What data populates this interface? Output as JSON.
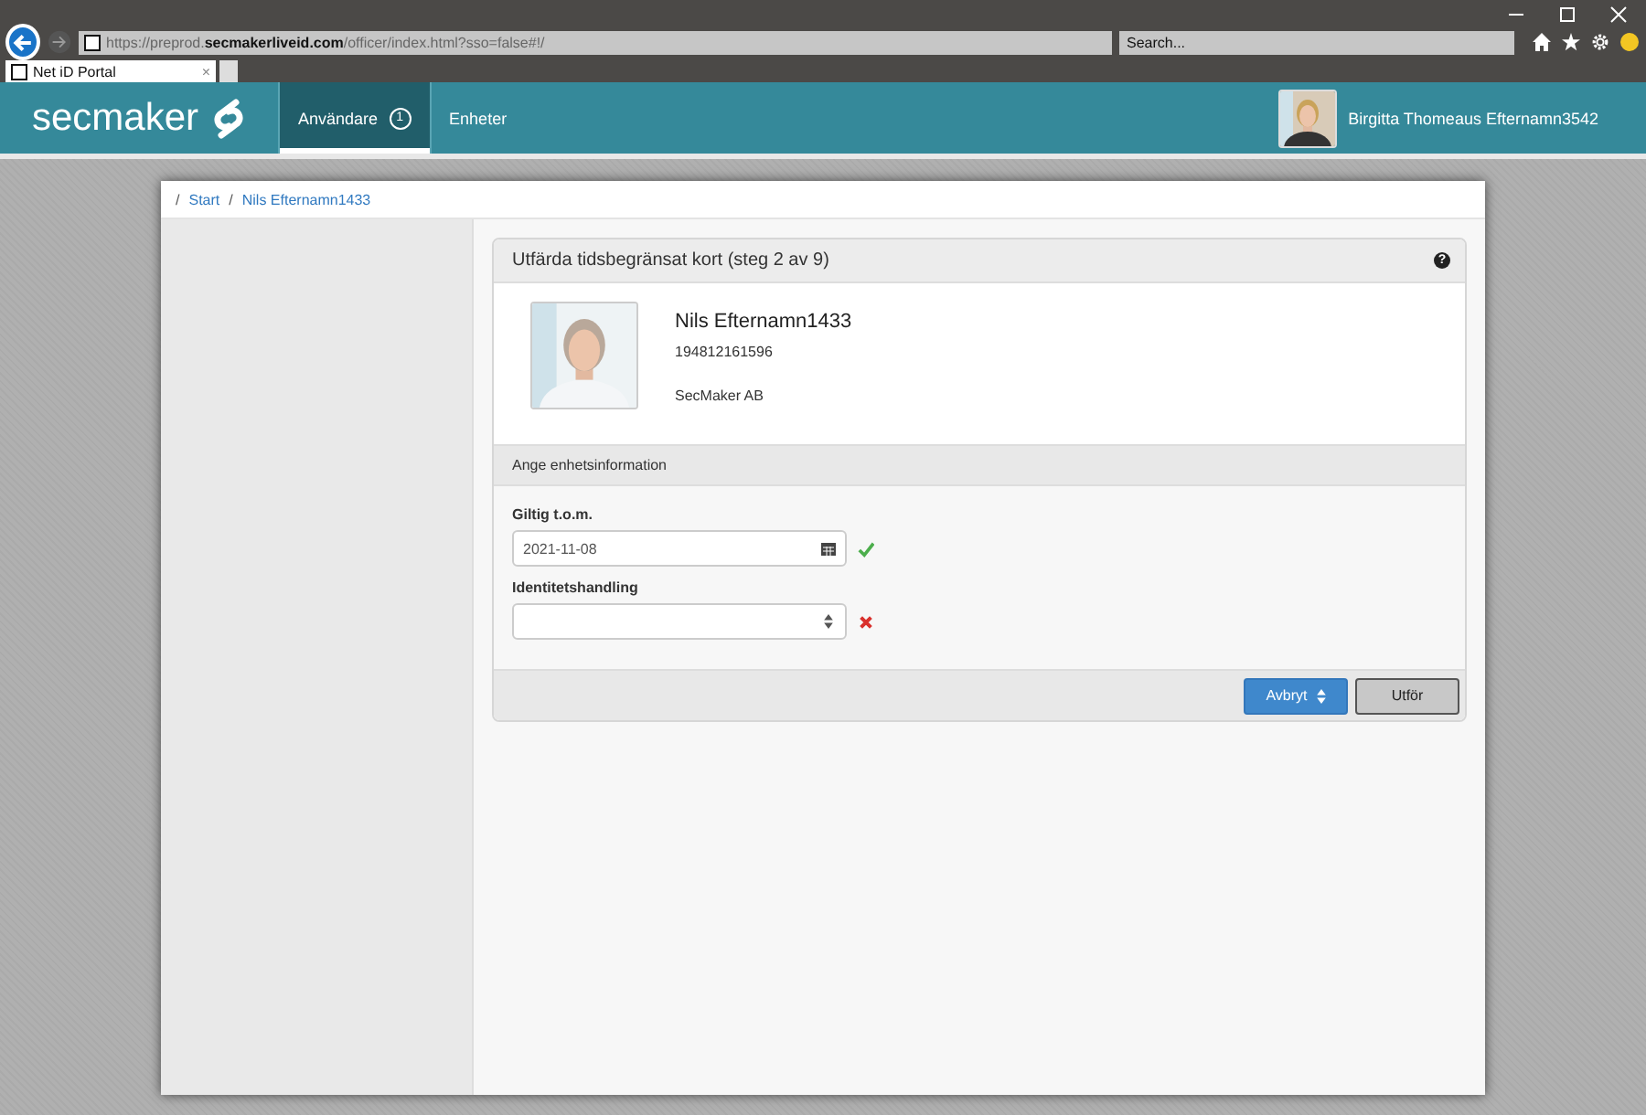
{
  "browser": {
    "url": "https://preprod.**secmakerliveid.com**/officer/index.html?sso=false#!/",
    "search": {
      "placeholder": "Search..."
    },
    "tabs": [
      {
        "label": "Net iD Portal",
        "close": "×",
        "selected": true
      }
    ]
  },
  "header": {
    "logo": "secmaker",
    "nav": [
      {
        "label": "Användare",
        "badge": "1",
        "selected": true
      },
      {
        "label": "Enheter",
        "selected": false
      }
    ],
    "user": "Birgitta Thomeaus Efternamn3542"
  },
  "breadcrumb": [
    {
      "separator": "/",
      "label": "Start"
    },
    {
      "separator": "/",
      "label": "Nils Efternamn1433"
    }
  ],
  "panel": {
    "title": "Utfärda tidsbegränsat kort (steg 2 av 9)",
    "help": "?",
    "person": {
      "name": "Nils Efternamn1433",
      "id": "194812161596",
      "org": "SecMaker AB"
    },
    "section": "Ange enhetsinformation",
    "fields": [
      {
        "label": "Giltig t.o.m.",
        "kind": "date",
        "value": "2021-11-08",
        "valid": true
      },
      {
        "label": "Identitetshandling",
        "kind": "select",
        "valid": false
      }
    ],
    "buttons": [
      {
        "label": "Avbryt",
        "kind": "primary"
      },
      {
        "label": "Utför",
        "kind": "default"
      }
    ]
  }
}
